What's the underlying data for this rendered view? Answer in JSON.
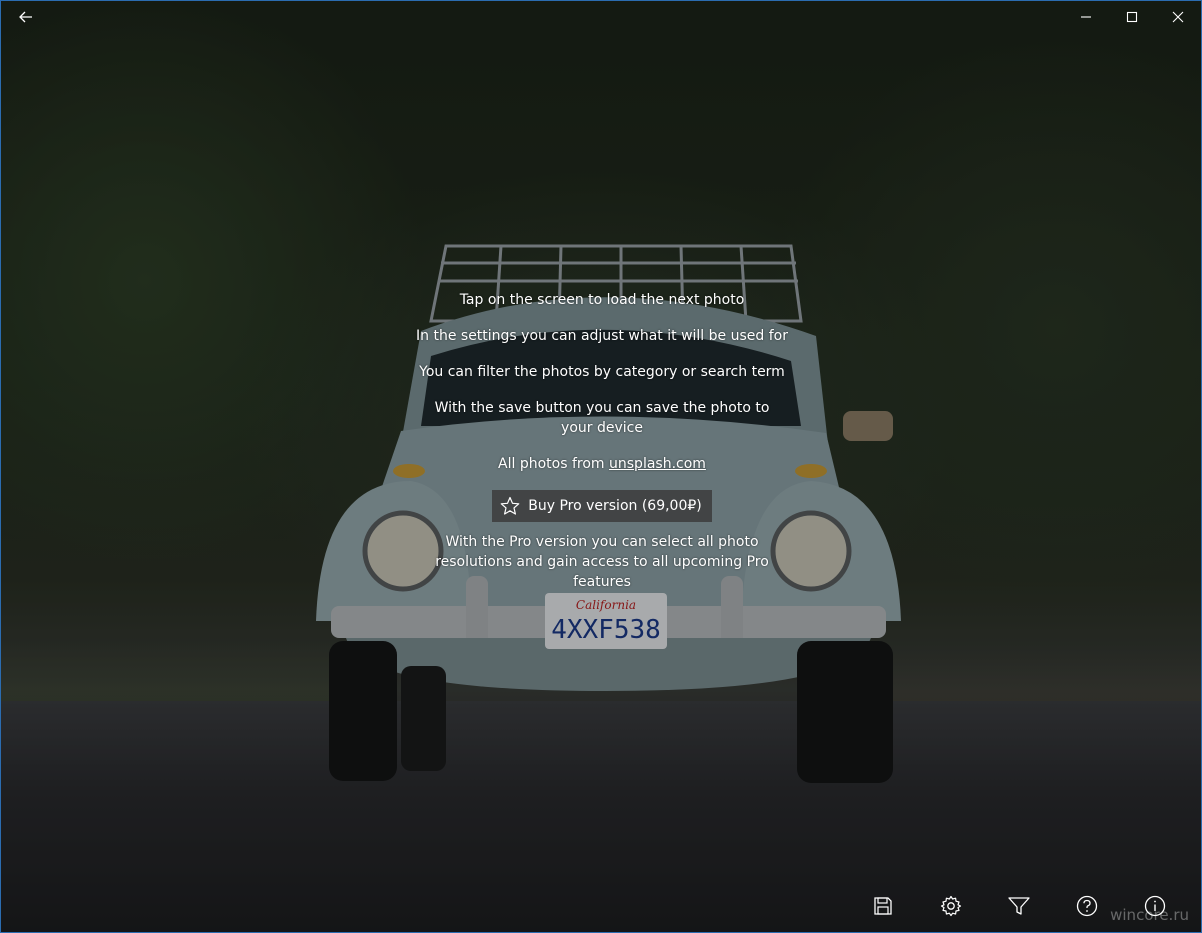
{
  "titlebar": {
    "back_icon": "back-arrow-icon",
    "minimize_icon": "minimize-icon",
    "maximize_icon": "maximize-icon",
    "close_icon": "close-icon"
  },
  "overlay": {
    "line1": "Tap on the screen to load the next photo",
    "line2": "In the settings you can adjust what it will be used for",
    "line3": "You can filter the photos by category or search term",
    "line4": "With the save button you can save the photo to your device",
    "credit_prefix": "All photos from ",
    "credit_link": "unsplash.com",
    "buy_label": "Buy Pro version (69,00₽)",
    "pro_description": "With the Pro version you can select all photo resolutions and gain access to all upcoming Pro features"
  },
  "photo": {
    "plate_state": "California",
    "plate_number": "4XXF538"
  },
  "commandbar": {
    "items": [
      "save-icon",
      "settings-gear-icon",
      "filter-icon",
      "help-icon",
      "info-icon"
    ]
  },
  "watermark": "wincore.ru",
  "colors": {
    "window_border": "#2b6cb0",
    "button_bg": "#3c3c3c",
    "text": "#ffffff"
  }
}
